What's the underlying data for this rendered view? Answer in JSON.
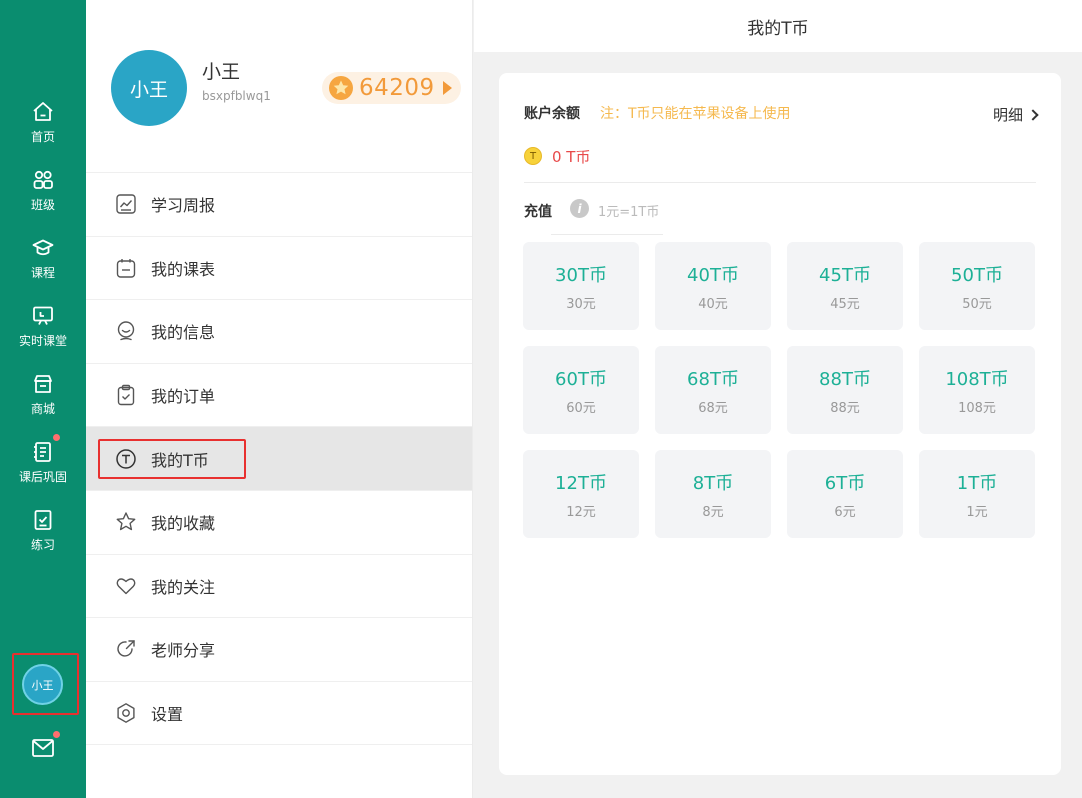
{
  "rail": {
    "items": [
      {
        "label": "首页",
        "icon": "home-icon"
      },
      {
        "label": "班级",
        "icon": "class-icon"
      },
      {
        "label": "课程",
        "icon": "graduation-cap-icon"
      },
      {
        "label": "实时课堂",
        "icon": "live-classroom-icon"
      },
      {
        "label": "商城",
        "icon": "shop-icon"
      },
      {
        "label": "课后巩固",
        "icon": "homework-icon",
        "badge": true
      },
      {
        "label": "练习",
        "icon": "practice-icon"
      }
    ],
    "avatar_label": "小王",
    "mail_badge": true,
    "accent": "#0a8d6f"
  },
  "profile": {
    "avatar_label": "小王",
    "name": "小王",
    "user_id": "bsxpfblwq1",
    "coins": "64209"
  },
  "menu": [
    {
      "label": "学习周报",
      "icon": "weekly-report-icon"
    },
    {
      "label": "我的课表",
      "icon": "schedule-icon"
    },
    {
      "label": "我的信息",
      "icon": "profile-info-icon"
    },
    {
      "label": "我的订单",
      "icon": "order-icon"
    },
    {
      "label": "我的T币",
      "icon": "t-coin-icon",
      "active": true
    },
    {
      "label": "我的收藏",
      "icon": "star-icon"
    },
    {
      "label": "我的关注",
      "icon": "heart-icon"
    },
    {
      "label": "老师分享",
      "icon": "share-icon"
    },
    {
      "label": "设置",
      "icon": "settings-icon"
    }
  ],
  "header": {
    "title": "我的T币"
  },
  "balance": {
    "label": "账户余额",
    "note": "注：T币只能在苹果设备上使用",
    "detail": "明细",
    "coin_glyph": "T",
    "value": "0 T币"
  },
  "recharge": {
    "label": "充值",
    "info_glyph": "i",
    "rate": "1元=1T币",
    "options": [
      {
        "amount": "30T币",
        "price": "30元"
      },
      {
        "amount": "40T币",
        "price": "40元"
      },
      {
        "amount": "45T币",
        "price": "45元"
      },
      {
        "amount": "50T币",
        "price": "50元"
      },
      {
        "amount": "60T币",
        "price": "60元"
      },
      {
        "amount": "68T币",
        "price": "68元"
      },
      {
        "amount": "88T币",
        "price": "88元"
      },
      {
        "amount": "108T币",
        "price": "108元"
      },
      {
        "amount": "12T币",
        "price": "12元"
      },
      {
        "amount": "8T币",
        "price": "8元"
      },
      {
        "amount": "6T币",
        "price": "6元"
      },
      {
        "amount": "1T币",
        "price": "1元"
      }
    ]
  }
}
